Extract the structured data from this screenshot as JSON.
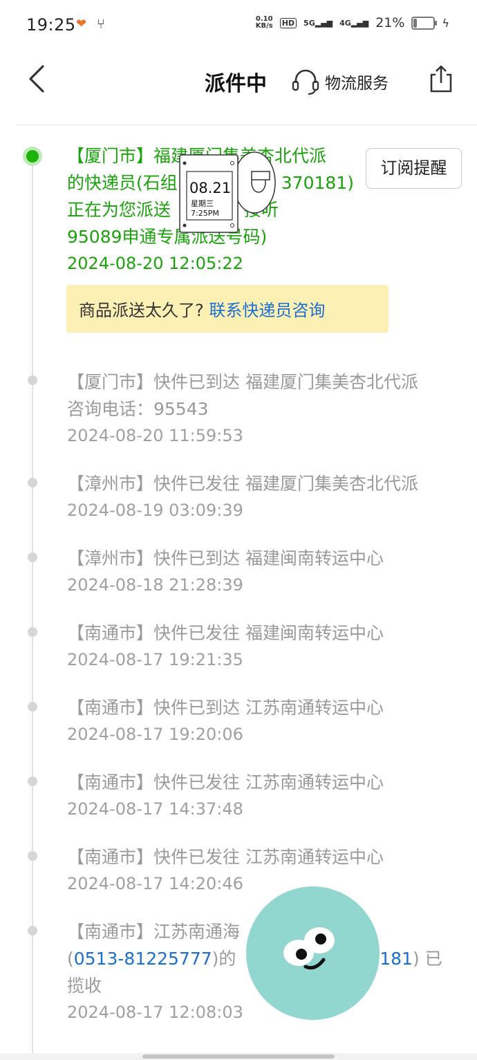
{
  "status_bar": {
    "time": "19:25",
    "speed_top": "0.10",
    "speed_bottom": "KB/s",
    "hd_tag": "HD",
    "net1": "5G",
    "net2": "4G",
    "battery_percent": "21%",
    "battery_level": 0.21
  },
  "header": {
    "title": "派件中",
    "service_label": "物流服务"
  },
  "subscribe_label": "订阅提醒",
  "notice": {
    "question": "商品派送太久了?",
    "link": "联系快递员咨询"
  },
  "events": [
    {
      "line1": "【厦门市】福建厦门集美杏北代派",
      "line2": "的快递员(石组",
      "line2b": "370181)",
      "line3": "正在为您派送",
      "line3b": "接听",
      "line4": "95089申通专属派送号码)",
      "time": "2024-08-20 12:05:22"
    },
    {
      "line1": "【厦门市】快件已到达 福建厦门集美杏北代派",
      "line2": "咨询电话：95543",
      "time": "2024-08-20 11:59:53"
    },
    {
      "line1": "【漳州市】快件已发往 福建厦门集美杏北代派",
      "time": "2024-08-19 03:09:39"
    },
    {
      "line1": "【漳州市】快件已到达 福建闽南转运中心",
      "time": "2024-08-18 21:28:39"
    },
    {
      "line1": "【南通市】快件已发往 福建闽南转运中心",
      "time": "2024-08-17 19:21:35"
    },
    {
      "line1": "【南通市】快件已到达 江苏南通转运中心",
      "time": "2024-08-17 19:20:06"
    },
    {
      "line1": "【南通市】快件已发往 江苏南通转运中心",
      "time": "2024-08-17 14:37:48"
    },
    {
      "line1": "【南通市】快件已发往 江苏南通转运中心",
      "time": "2024-08-17 14:20:46"
    },
    {
      "line1": "【南通市】江苏南通海",
      "line2_pre": "(",
      "phone1": "0513-81225777",
      "line2_mid": ")的",
      "phone2": "77181",
      "line2_post": ") 已",
      "line3": "揽收",
      "time": "2024-08-17 12:08:03"
    }
  ],
  "clock_sticker": {
    "date": "08.21",
    "weekday": "星期三",
    "time": "7:25PM"
  },
  "colors": {
    "active_green": "#1aa30b",
    "link_blue": "#1a6fd1",
    "notice_bg": "#fdf0b4"
  }
}
